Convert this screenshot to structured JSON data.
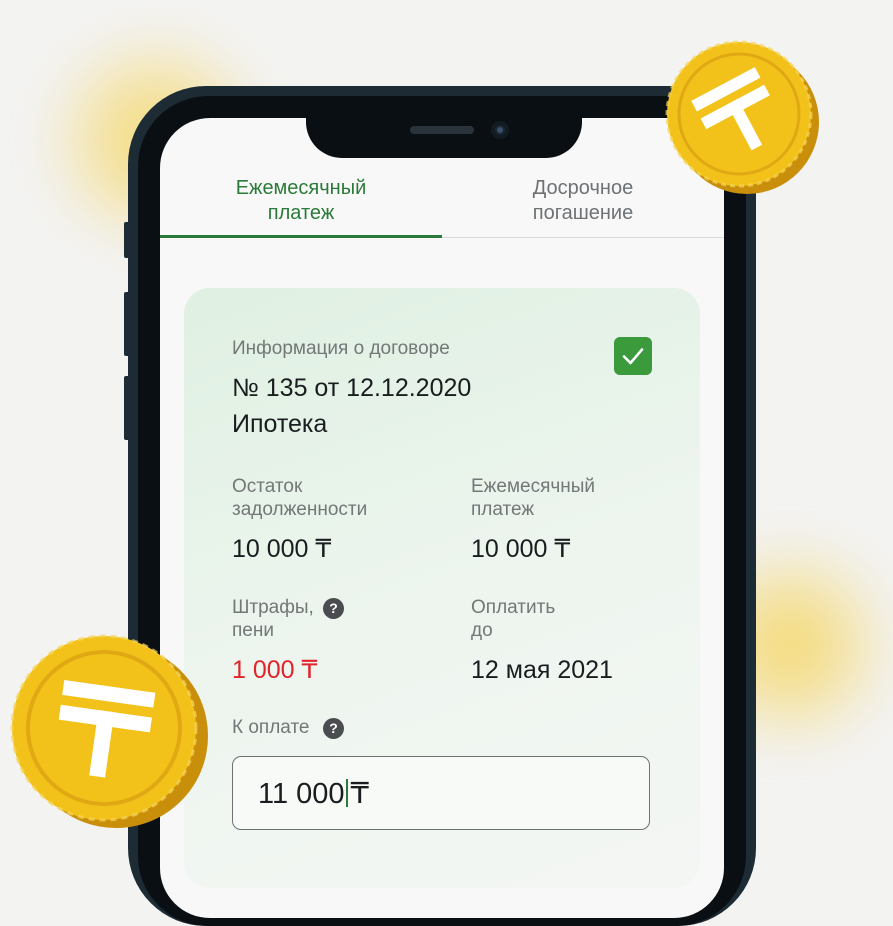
{
  "tabs": {
    "monthly": "Ежемесячный\nплатеж",
    "early": "Досрочное\nпогашение"
  },
  "contract": {
    "section_label": "Информация о договоре",
    "number_line": "№ 135 от 12.12.2020",
    "type": "Ипотека",
    "checked": true
  },
  "balance": {
    "label": "Остаток\nзадолженности",
    "value": "10 000 ₸"
  },
  "monthly_payment": {
    "label": "Ежемесячный\nплатеж",
    "value": "10 000 ₸"
  },
  "penalties": {
    "label": "Штрафы,\nпени",
    "value": "1 000 ₸",
    "help_icon": "?"
  },
  "due": {
    "label": "Оплатить\nдо",
    "value": "12 мая 2021"
  },
  "to_pay": {
    "label": "К оплате",
    "help_icon": "?",
    "amount": "11 000",
    "currency": "₸"
  },
  "colors": {
    "accent": "#2c7a3a",
    "penalty": "#e0242b",
    "coin": "#f2c21a"
  },
  "icons": [
    "checkbox-checked-icon",
    "help-icon",
    "tenge-coin-icon"
  ]
}
